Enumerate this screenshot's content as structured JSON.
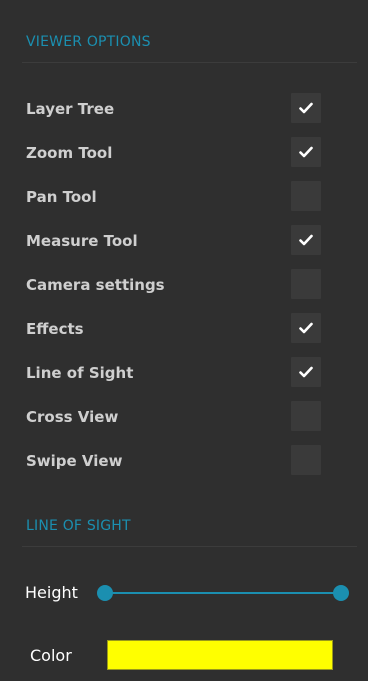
{
  "viewer_options": {
    "title": "VIEWER OPTIONS",
    "items": [
      {
        "label": "Layer Tree",
        "checked": true
      },
      {
        "label": "Zoom Tool",
        "checked": true
      },
      {
        "label": "Pan Tool",
        "checked": false
      },
      {
        "label": "Measure Tool",
        "checked": true
      },
      {
        "label": "Camera settings",
        "checked": false
      },
      {
        "label": "Effects",
        "checked": true
      },
      {
        "label": "Line of Sight",
        "checked": true
      },
      {
        "label": "Cross View",
        "checked": false
      },
      {
        "label": "Swipe View",
        "checked": false
      }
    ]
  },
  "line_of_sight": {
    "title": "LINE OF SIGHT",
    "height_label": "Height",
    "height_range": [
      0,
      1
    ],
    "color_label": "Color",
    "color_value": "#ffff00"
  },
  "colors": {
    "accent": "#1b8fb0",
    "panel_bg": "#2f2f2f",
    "checkbox_bg": "#3a3a3a",
    "label_text": "#cfcfcf"
  },
  "icons": {
    "checkmark": "checkmark-icon"
  }
}
